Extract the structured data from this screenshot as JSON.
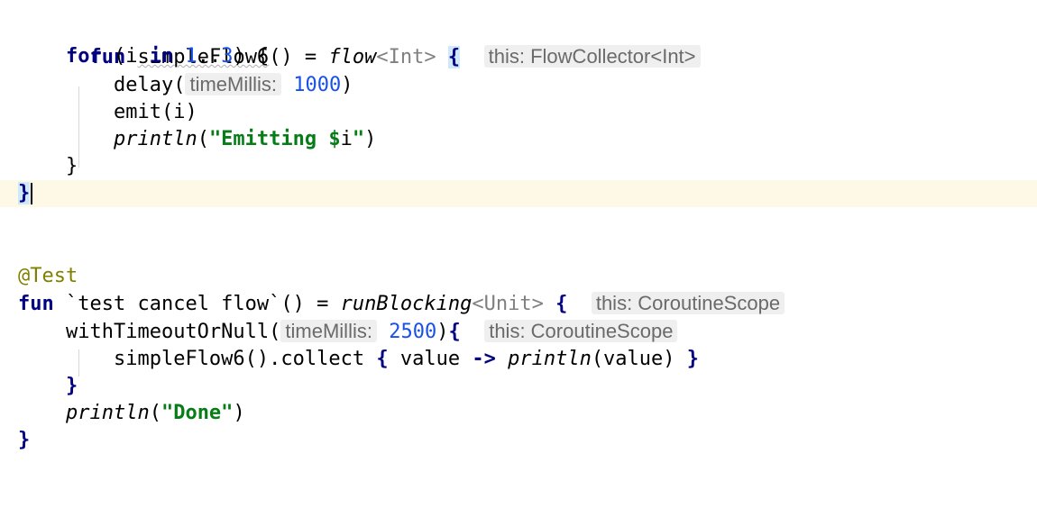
{
  "editor": {
    "lines": {
      "l1": {
        "kw_fun": "fun",
        "fn_name": "simpleFlow6",
        "parens_eq": "() = ",
        "flow": "flow",
        "generic": "<Int>",
        "brace": "{",
        "hint": "this: FlowCollector<Int>"
      },
      "l2": {
        "kw_for": "for",
        "open": " (i ",
        "kw_in": "in",
        "sp": " ",
        "num1": "1",
        "range": "..",
        "num3": "3",
        "close": ") {"
      },
      "l3": {
        "call": "delay(",
        "hint": "timeMillis:",
        "num": "1000",
        "close": ")"
      },
      "l4": {
        "text": "emit(i)"
      },
      "l5": {
        "fn": "println",
        "open": "(",
        "str": "\"Emitting ",
        "tmpl": "$",
        "var": "i",
        "qclose": "\"",
        "close": ")"
      },
      "l6": {
        "text": "}"
      },
      "l7": {
        "text": "}"
      },
      "l9": {
        "text": "@Test"
      },
      "l10": {
        "kw_fun": "fun",
        "name": " `test cancel flow`() = ",
        "fn": "runBlocking",
        "generic": "<Unit>",
        "brace": "{",
        "hint": "this: CoroutineScope"
      },
      "l11": {
        "call": "withTimeoutOrNull(",
        "hint": "timeMillis:",
        "num": "2500",
        "close": ")",
        "brace": "{",
        "hint2": "this: CoroutineScope"
      },
      "l12": {
        "pre": "simpleFlow6().collect ",
        "ob": "{",
        "param": " value ",
        "arrow": "->",
        "sp": " ",
        "fn": "println",
        "args": "(value) ",
        "cb": "}"
      },
      "l13": {
        "text": "}"
      },
      "l14": {
        "fn": "println",
        "open": "(",
        "str": "\"Done\"",
        "close": ")"
      },
      "l15": {
        "text": "}"
      }
    }
  }
}
